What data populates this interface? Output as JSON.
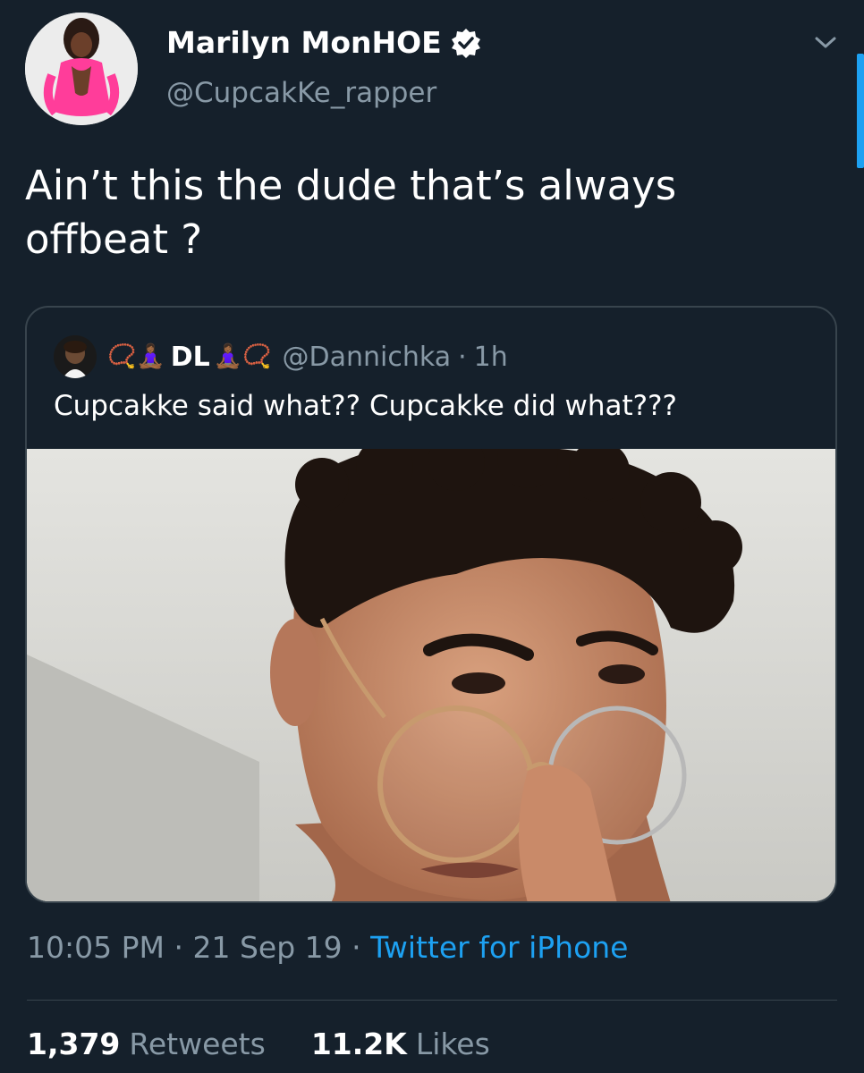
{
  "tweet": {
    "display_name": "Marilyn MonHOE",
    "handle": "@CupcakKe_rapper",
    "verified_icon": "verified-badge-icon",
    "text": "Ain’t this the dude that’s always offbeat ?",
    "timestamp": "10:05 PM",
    "date": "21 Sep 19",
    "separator": "·",
    "source": "Twitter for iPhone"
  },
  "quoted": {
    "name_prefix_emoji": "📿🧘🏾‍♀️",
    "display_name": "DL",
    "name_suffix_emoji": "🧘🏾‍♀️📿",
    "handle": "@Dannichka",
    "separator": "·",
    "time": "1h",
    "text": "Cupcakke said what?? Cupcakke did what???"
  },
  "stats": {
    "retweets_count": "1,379",
    "retweets_label": "Retweets",
    "likes_count": "11.2K",
    "likes_label": "Likes"
  },
  "colors": {
    "background": "#15202b",
    "muted": "#8899a6",
    "accent": "#1da1f2",
    "border": "#38444d"
  }
}
